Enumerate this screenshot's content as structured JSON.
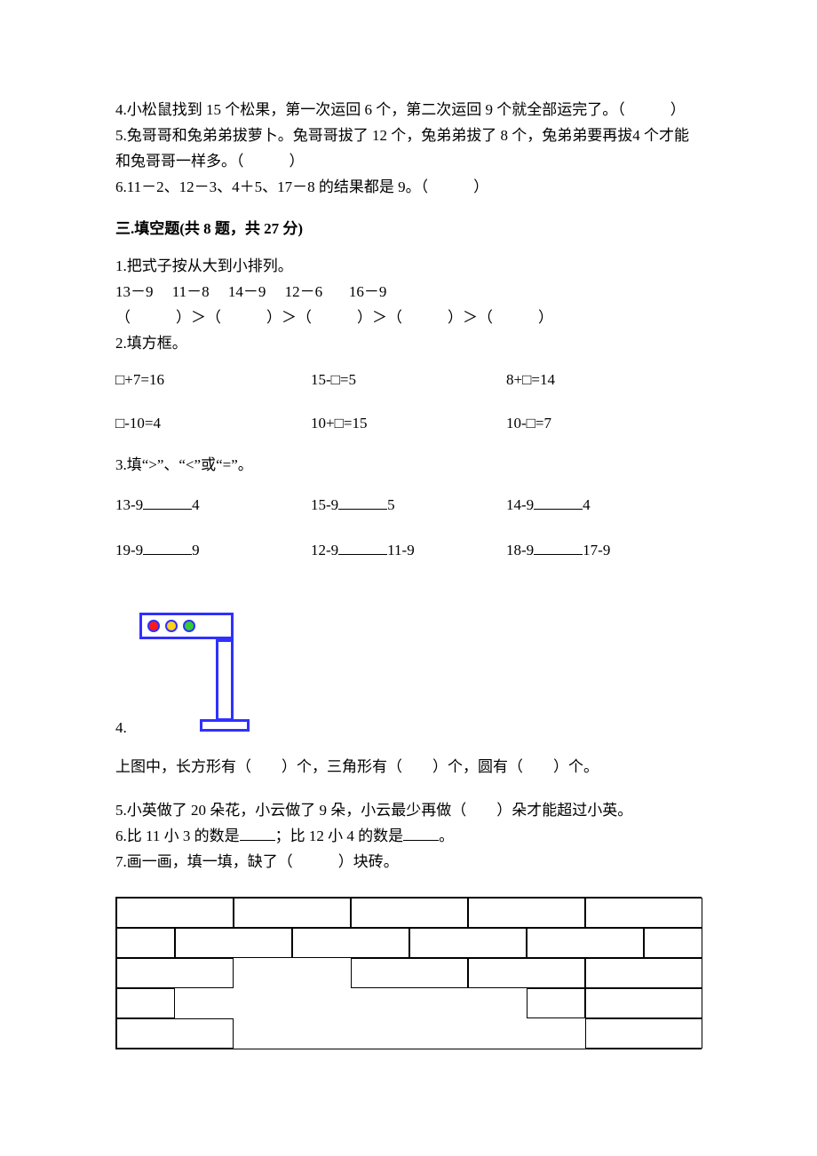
{
  "tf": {
    "q4": "4.小松鼠找到 15 个松果，第一次运回 6 个，第二次运回 9 个就全部运完了。（　　　）",
    "q5": "5.兔哥哥和兔弟弟拔萝卜。兔哥哥拔了 12 个，兔弟弟拔了 8 个，兔弟弟要再拔4 个才能和兔哥哥一样多。（　　　）",
    "q6": "6.11－2、12－3、4＋5、17－8 的结果都是 9。（　　　）"
  },
  "section3": {
    "heading": "三.填空题(共 8 题，共 27 分)",
    "q1": {
      "stem": "1.把式子按从大到小排列。",
      "exprs": [
        "13－9",
        "11－8",
        "14－9",
        "12－6",
        "16－9"
      ],
      "compare_template": "（　　　）＞（　　　）＞（　　　）＞（　　　）＞（　　　）"
    },
    "q2": {
      "stem": "2.填方框。",
      "row1": [
        "□+7=16",
        "15-□=5",
        "8+□=14"
      ],
      "row2": [
        "□-10=4",
        "10+□=15",
        "10-□=7"
      ]
    },
    "q3": {
      "stem": "3.填“>”、“<”或“=”。",
      "row1": [
        {
          "l": "13-9",
          "r": "4"
        },
        {
          "l": "15-9",
          "r": "5"
        },
        {
          "l": "14-9",
          "r": "4"
        }
      ],
      "row2": [
        {
          "l": "19-9",
          "r": "9"
        },
        {
          "l": "12-9",
          "r": "11-9"
        },
        {
          "l": "18-9",
          "r": "17-9"
        }
      ]
    },
    "q4": {
      "num": "4.",
      "line": "上图中，长方形有（　　）个，三角形有（　　）个，圆有（　　）个。"
    },
    "q5": "5.小英做了 20 朵花，小云做了 9 朵，小云最少再做（　　）朵才能超过小英。",
    "q6": {
      "pre": "6.比 11 小 3 的数是",
      "mid": "；比 12 小 4 的数是",
      "post": "。"
    },
    "q7": "7.画一画，填一填，缺了（　　　）块砖。"
  }
}
